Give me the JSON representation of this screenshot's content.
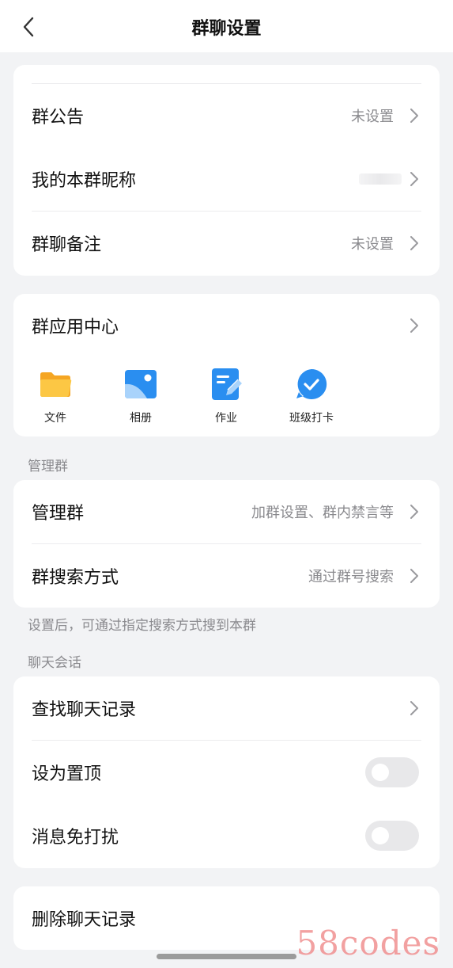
{
  "header": {
    "title": "群聊设置"
  },
  "card1": {
    "announcement": {
      "label": "群公告",
      "value": "未设置"
    },
    "nickname": {
      "label": "我的本群昵称"
    },
    "remark": {
      "label": "群聊备注",
      "value": "未设置"
    }
  },
  "apps": {
    "title": "群应用中心",
    "items": [
      {
        "label": "文件",
        "icon": "folder-icon",
        "color": "#f7b733"
      },
      {
        "label": "相册",
        "icon": "photo-album-icon",
        "color": "#2a8ef0"
      },
      {
        "label": "作业",
        "icon": "homework-icon",
        "color": "#2a8ef0"
      },
      {
        "label": "班级打卡",
        "icon": "check-in-icon",
        "color": "#2a8ef0"
      }
    ]
  },
  "manage": {
    "section_label": "管理群",
    "manage_row": {
      "label": "管理群",
      "value": "加群设置、群内禁言等"
    },
    "search_row": {
      "label": "群搜索方式",
      "value": "通过群号搜索"
    },
    "hint": "设置后，可通过指定搜索方式搜到本群"
  },
  "chat": {
    "section_label": "聊天会话",
    "find_history": {
      "label": "查找聊天记录"
    },
    "pin": {
      "label": "设为置顶",
      "on": false
    },
    "mute": {
      "label": "消息免打扰",
      "on": false
    }
  },
  "delete": {
    "label": "删除聊天记录"
  },
  "watermark": "58codes"
}
